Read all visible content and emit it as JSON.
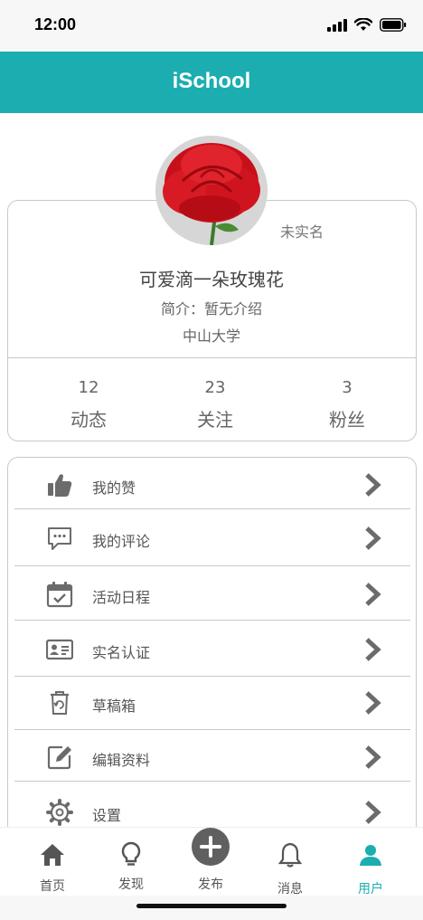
{
  "status_bar": {
    "time": "12:00"
  },
  "app_bar": {
    "title": "iSchool"
  },
  "profile": {
    "verify_status": "未实名",
    "username": "可爱滴一朵玫瑰花",
    "bio": "简介：暂无介绍",
    "school": "中山大学",
    "stats": [
      {
        "value": "12",
        "label": "动态"
      },
      {
        "value": "23",
        "label": "关注"
      },
      {
        "value": "3",
        "label": "粉丝"
      }
    ]
  },
  "menu": {
    "items": [
      {
        "label": "我的赞",
        "icon": "thumbs-up-icon"
      },
      {
        "label": "我的评论",
        "icon": "comment-icon"
      },
      {
        "label": "活动日程",
        "icon": "calendar-check-icon"
      },
      {
        "label": "实名认证",
        "icon": "id-card-icon"
      },
      {
        "label": "草稿箱",
        "icon": "draft-bin-icon"
      },
      {
        "label": "编辑资料",
        "icon": "edit-icon"
      },
      {
        "label": "设置",
        "icon": "gear-icon"
      }
    ]
  },
  "tabbar": {
    "active": "用户",
    "active_color": "#1cadb0",
    "tabs": [
      {
        "label": "首页",
        "icon": "home-icon"
      },
      {
        "label": "发现",
        "icon": "lightbulb-icon"
      },
      {
        "label": "发布",
        "icon": "plus-circle-icon"
      },
      {
        "label": "消息",
        "icon": "bell-icon"
      },
      {
        "label": "用户",
        "icon": "user-icon"
      }
    ]
  },
  "colors": {
    "accent": "#1cadb0",
    "icon_gray": "#6b6b6b"
  }
}
